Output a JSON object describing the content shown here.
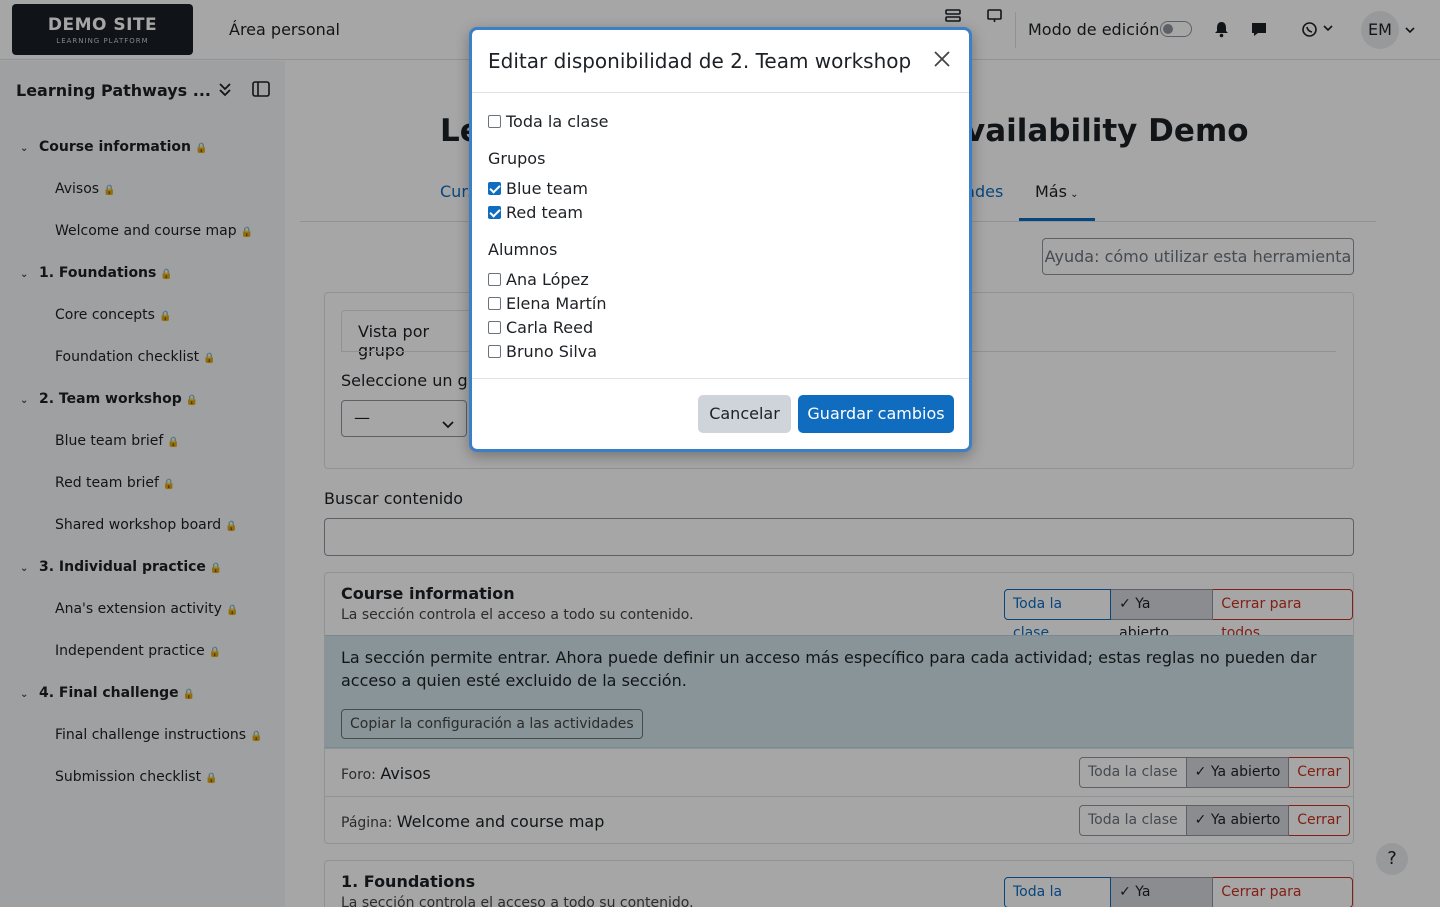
{
  "brand": {
    "name": "DEMO SITE",
    "tagline": "LEARNING PLATFORM"
  },
  "nav": {
    "home": "Área personal",
    "edit_mode_label": "Modo de edición",
    "avatar_initials": "EM"
  },
  "drawer": {
    "title": "Learning Pathways ...",
    "tree": [
      {
        "label": "Course information",
        "items": [
          "Avisos",
          "Welcome and course map"
        ]
      },
      {
        "label": "1. Foundations",
        "items": [
          "Core concepts",
          "Foundation checklist"
        ]
      },
      {
        "label": "2. Team workshop",
        "items": [
          "Blue team brief",
          "Red team brief",
          "Shared workshop board"
        ]
      },
      {
        "label": "3. Individual practice",
        "items": [
          "Ana's extension activity",
          "Independent practice"
        ]
      },
      {
        "label": "4. Final challenge",
        "items": [
          "Final challenge instructions",
          "Submission checklist"
        ]
      }
    ]
  },
  "main": {
    "title_left": "Le",
    "title_right": "vailability Demo",
    "tabs": {
      "first": "Curs",
      "second": "dades",
      "more": "Más"
    },
    "help_button": "Ayuda: cómo utilizar esta herramienta",
    "view_tab": "Vista por grupo",
    "select_label": "Seleccione un gr",
    "select_value": "—",
    "search_label": "Buscar contenido",
    "sections": [
      {
        "title": "Course information",
        "subtitle": "La sección controla el acceso a todo su contenido.",
        "info": "La sección permite entrar. Ahora puede definir un acceso más específico para cada actividad; estas reglas no pueden dar acceso a quien esté excluido de la sección.",
        "copy_button": "Copiar la configuración a las actividades",
        "activities": [
          {
            "type": "Foro:",
            "name": "Avisos"
          },
          {
            "type": "Página:",
            "name": "Welcome and course map"
          }
        ]
      },
      {
        "title": "1. Foundations",
        "subtitle": "La sección controla el acceso a todo su contenido."
      }
    ],
    "buttons": {
      "whole_class": "Toda la clase",
      "already_open": "✓ Ya abierto",
      "close_all": "Cerrar para todos",
      "close": "Cerrar"
    }
  },
  "modal": {
    "title": "Editar disponibilidad de 2. Team workshop",
    "whole_class": {
      "label": "Toda la clase",
      "checked": false
    },
    "groups_header": "Grupos",
    "groups": [
      {
        "label": "Blue team",
        "checked": true
      },
      {
        "label": "Red team",
        "checked": true
      }
    ],
    "students_header": "Alumnos",
    "students": [
      {
        "label": "Ana López",
        "checked": false
      },
      {
        "label": "Elena Martín",
        "checked": false
      },
      {
        "label": "Carla Reed",
        "checked": false
      },
      {
        "label": "Bruno Silva",
        "checked": false
      }
    ],
    "cancel": "Cancelar",
    "save": "Guardar cambios"
  },
  "icons": {
    "lock": "lock-icon",
    "help": "?",
    "close": "×"
  },
  "colors": {
    "primary": "#0f6cbf",
    "danger": "#ca3120",
    "info_bg": "#d2e4e8"
  }
}
